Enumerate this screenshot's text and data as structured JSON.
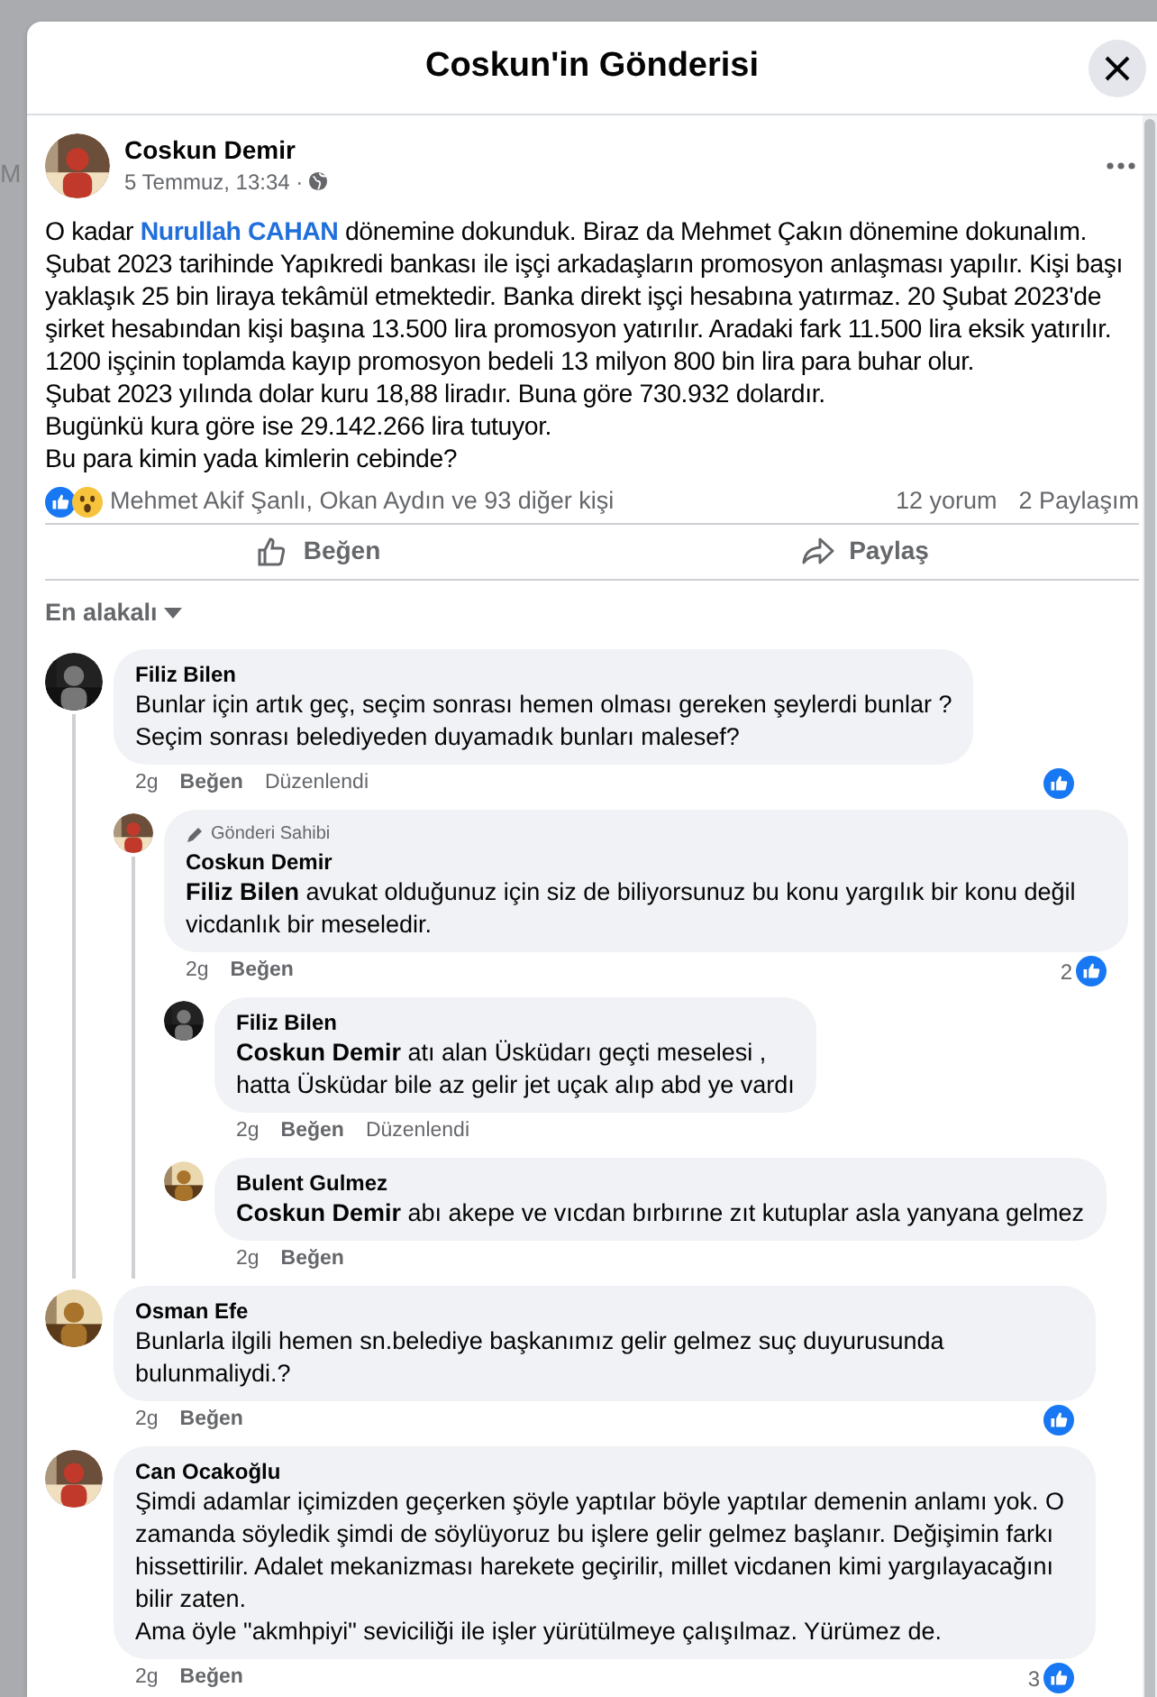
{
  "background": {
    "fragment": "M"
  },
  "dialog": {
    "title": "Coskun'in Gönderisi"
  },
  "post": {
    "author": "Coskun Demir",
    "time": "5 Temmuz, 13:34 ·",
    "lead": {
      "before": "O kadar ",
      "mention": "Nurullah CAHAN",
      "after": "  dönemine dokunduk. Biraz da Mehmet Çakın dönemine dokunalım."
    },
    "paragraphs": [
      "Şubat 2023 tarihinde Yapıkredi bankası ile işçi arkadaşların promosyon anlaşması yapılır.  Kişi başı yaklaşık 25 bin liraya tekâmül etmektedir. Banka direkt işçi hesabına yatırmaz. 20 Şubat 2023'de şirket hesabından kişi başına 13.500 lira promosyon yatırılır. Aradaki fark 11.500 lira eksik yatırılır. 1200 işçinin toplamda kayıp promosyon bedeli 13 milyon 800 bin lira para buhar olur.",
      "Şubat 2023 yılında dolar kuru 18,88 liradır. Buna göre 730.932 dolardır.",
      "Bugünkü kura göre ise 29.142.266 lira tutuyor.",
      "Bu para kimin yada kimlerin cebinde?"
    ],
    "reactions": "Mehmet Akif Şanlı, Okan Aydın ve 93 diğer kişi",
    "comments_count": "12 yorum",
    "shares_count": "2 Paylaşım",
    "actions": [
      {
        "kind": "like",
        "label": "Beğen"
      },
      {
        "kind": "share",
        "label": "Paylaş"
      }
    ]
  },
  "sort": {
    "label": "En alakalı"
  },
  "comments": [
    {
      "author": "Filiz Bilen",
      "text": "Bunlar için artık geç, seçim sonrası hemen olması gereken şeylerdi bunlar ?\nSeçim sonrası belediyeden duyamadık bunları malesef?",
      "time": "2g",
      "like": "Beğen",
      "edited": "Düzenlendi",
      "reacted": true,
      "children": [
        {
          "author": "Coskun Demir",
          "badge": "Gönderi Sahibi",
          "mention": "Filiz Bilen",
          "text": " avukat olduğunuz için siz de biliyorsunuz bu konu yargılık bir konu değil vicdanlık bir meseledir.",
          "time": "2g",
          "like": "Beğen",
          "reacted": true,
          "reaction_count": "2",
          "children": [
            {
              "author": "Filiz Bilen",
              "mention": "Coskun Demir",
              "text": " atı alan Üsküdarı geçti meselesi ,\nhatta Üsküdar bile az gelir jet uçak alıp abd ye vardı",
              "time": "2g",
              "like": "Beğen",
              "edited": "Düzenlendi",
              "reacted": false
            },
            {
              "author": "Bulent Gulmez",
              "mention": "Coskun Demir",
              "text": " abı akepe ve vıcdan bırbırıne zıt kutuplar asla yanyana gelmez",
              "time": "2g",
              "like": "Beğen",
              "reacted": false
            }
          ]
        }
      ]
    },
    {
      "author": "Osman Efe",
      "text": "Bunlarla ilgili hemen sn.belediye başkanımız gelir gelmez suç duyurusunda bulunmaliydi.?",
      "time": "2g",
      "like": "Beğen",
      "reacted": true
    },
    {
      "author": "Can Ocakoğlu",
      "text": "Şimdi adamlar içimizden geçerken şöyle yaptılar böyle yaptılar demenin anlamı yok. O zamanda söyledik şimdi de söylüyoruz bu işlere gelir gelmez başlanır. Değişimin farkı hissettirilir. Adalet mekanizması harekete geçirilir, millet vicdanen kimi yargılayacağını bilir zaten.\nAma öyle \"akmhpiyi\" seviciliği ile işler yürütülmeye çalışılmaz. Yürümez de.",
      "time": "2g",
      "like": "Beğen",
      "reacted": true,
      "reaction_count": "3"
    }
  ]
}
